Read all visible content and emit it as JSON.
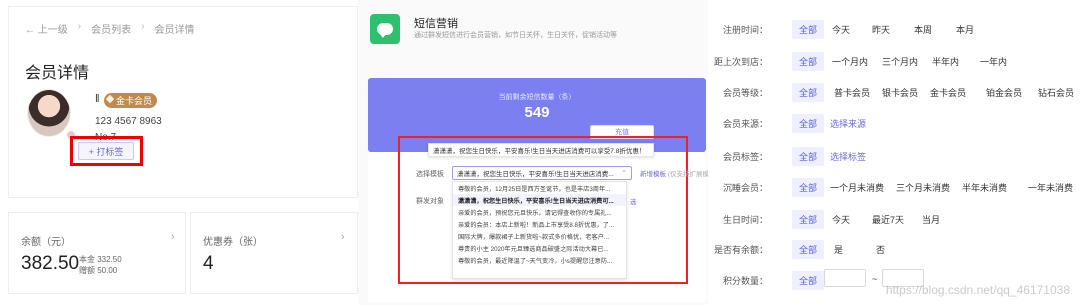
{
  "left": {
    "breadcrumb": [
      "← 上一级",
      "会员列表",
      "会员详情"
    ],
    "breadcrumb_sep": "›",
    "page_title": "会员详情",
    "member": {
      "name_marker": "‖",
      "level": "金卡会员",
      "phone": "123 4567 8963",
      "number": "No.7",
      "tag_button": "+ 打标签"
    },
    "balance": {
      "label": "余额（元）",
      "value": "382.50",
      "principal": "本金 332.50",
      "bonus": "赠额 50.00",
      "arrow": "›"
    },
    "coupons": {
      "label": "优惠券（张）",
      "value": "4",
      "arrow": "›"
    }
  },
  "middle": {
    "sms_title": "短信营销",
    "sms_desc": "通过群发短信进行会员营销，如节日关怀，生日关怀，促销活动等",
    "remaining_label": "当前剩余短信数量（条）",
    "remaining_value": "549",
    "recharge_button": "充值",
    "preview_bubble": "潇潇潇，祝您生日快乐，平安喜乐!生日当天进店消费可以享受7.8折优惠！",
    "template_label": "选择模板",
    "template_selected": "潇潇潇，祝您生日快乐，平安喜乐!生日当天进店消费...",
    "new_template": "新增模板",
    "new_template_hint": "(仅支持扩展模板)",
    "target_label": "群发对象",
    "side_link": "选",
    "templates": [
      "尊敬的会员，12月25日是西方圣诞节，也是丰店3周年...",
      "潇潇潇，祝您生日快乐，平安喜乐!生日当天进店消费可...",
      "亲爱的会员，预祝您元旦快乐，请记得查收你的专属礼...",
      "亲爱的会员：本店上新啦！新品上市享受8.8折优惠，了...",
      "国际大牌，爆款裙子上新货啦~款式多价格优，老客户...",
      "尊贵的小主 2020年元旦臻选商品破盛之际活动大幕已...",
      "尊敬的会员，最近降温了~天气变冷，小s提醒您注意防..."
    ],
    "selected_template_index": 1
  },
  "right": {
    "filters": [
      {
        "label": "注册时间：",
        "options": [
          "全部",
          "今天",
          "昨天",
          "本周",
          "本月"
        ]
      },
      {
        "label": "距上次到店：",
        "options": [
          "全部",
          "一个月内",
          "三个月内",
          "半年内",
          "一年内"
        ]
      },
      {
        "label": "会员等级：",
        "options": [
          "全部",
          "普卡会员",
          "银卡会员",
          "金卡会员",
          "铂金会员",
          "钻石会员"
        ]
      },
      {
        "label": "会员来源：",
        "options": [
          "全部",
          "选择来源"
        ]
      },
      {
        "label": "会员标签：",
        "options": [
          "全部",
          "选择标签"
        ]
      },
      {
        "label": "沉睡会员：",
        "options": [
          "全部",
          "一个月未消费",
          "三个月未消费",
          "半年未消费",
          "一年未消费"
        ]
      },
      {
        "label": "生日时间：",
        "options": [
          "全部",
          "今天",
          "最近7天",
          "当月"
        ]
      },
      {
        "label": "是否有余额：",
        "options": [
          "全部",
          "是",
          "否"
        ]
      },
      {
        "label": "积分数量：",
        "options": [
          "全部"
        ],
        "range_sep": "~"
      }
    ],
    "watermark": "https://blog.csdn.net/qq_46171038"
  },
  "colors": {
    "accent": "#7b7ff0",
    "highlight_red": "#e00000",
    "sms_green": "#2ec06d",
    "badge_gold": "#c08a4f"
  }
}
